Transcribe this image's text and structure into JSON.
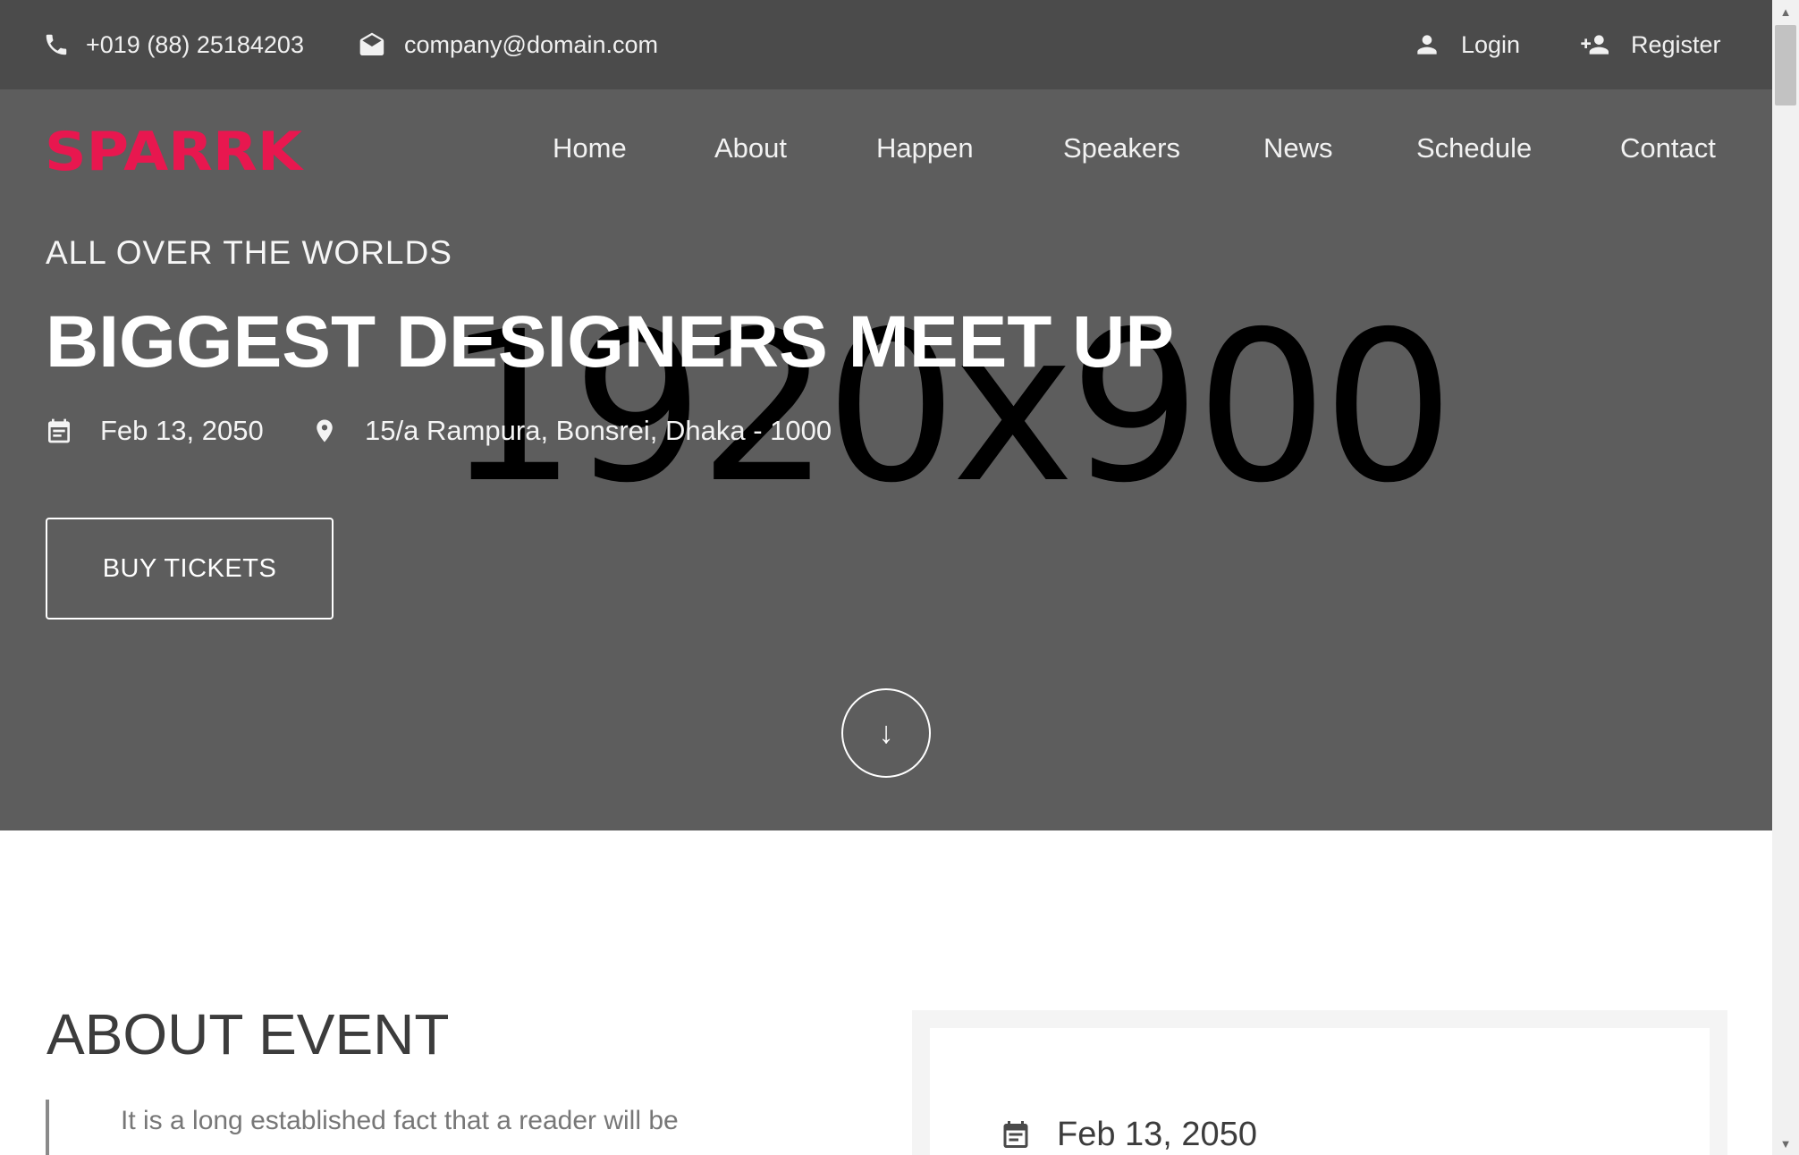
{
  "topbar": {
    "phone": "+019 (88) 25184203",
    "email": "company@domain.com",
    "login_label": "Login",
    "register_label": "Register"
  },
  "brand": {
    "logo_text": "SPARRK",
    "logo_color": "#e8174f"
  },
  "nav": {
    "items": [
      {
        "label": "Home"
      },
      {
        "label": "About"
      },
      {
        "label": "Happen"
      },
      {
        "label": "Speakers"
      },
      {
        "label": "News"
      },
      {
        "label": "Schedule"
      },
      {
        "label": "Contact"
      }
    ]
  },
  "hero": {
    "placeholder": "1920x900",
    "kicker": "ALL OVER THE WORLDS",
    "headline": "BIGGEST DESIGNERS MEET UP",
    "date": "Feb 13, 2050",
    "location": "15/a Rampura, Bonsrei, Dhaka - 1000",
    "buy_label": "BUY TICKETS",
    "scroll_glyph": "↓"
  },
  "about": {
    "title": "ABOUT EVENT",
    "quote": "It is a long established fact that a reader will be",
    "card_date": "Feb 13, 2050"
  },
  "colors": {
    "topbar_bg": "#4b4b4b",
    "hero_bg": "#5d5d5d",
    "accent": "#e8174f"
  },
  "icons": {
    "phone": "phone-icon",
    "mail": "mail-icon",
    "login": "user-icon",
    "register": "user-add-icon",
    "date": "calendar-icon",
    "location": "map-pin-icon"
  }
}
